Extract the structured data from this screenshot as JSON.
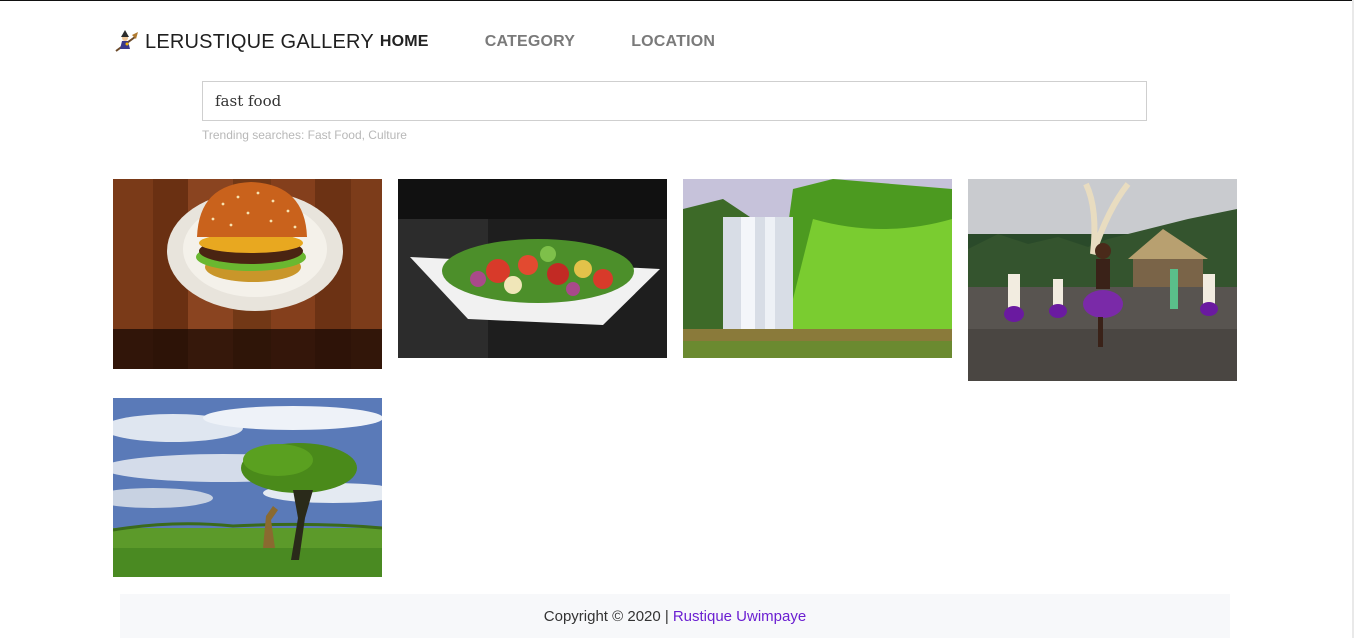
{
  "brand": {
    "name": "LERUSTIQUE GALLERY",
    "logo_icon": "witch-on-broom-icon"
  },
  "nav": {
    "items": [
      {
        "label": "HOME",
        "active": true
      },
      {
        "label": "CATEGORY",
        "active": false
      },
      {
        "label": "LOCATION",
        "active": false
      }
    ]
  },
  "search": {
    "value": "fast food",
    "trending": "Trending searches: Fast Food, Culture"
  },
  "gallery": {
    "images": [
      {
        "subject": "burger-on-plate"
      },
      {
        "subject": "salad-bowl"
      },
      {
        "subject": "waterfall"
      },
      {
        "subject": "cultural-dancers"
      },
      {
        "subject": "giraffe-under-tree"
      }
    ]
  },
  "footer": {
    "copyright": "Copyright © 2020 |",
    "author": "Rustique Uwimpaye"
  },
  "colors": {
    "accent_link": "#6b1fd1",
    "footer_bg": "#f7f8fa"
  }
}
